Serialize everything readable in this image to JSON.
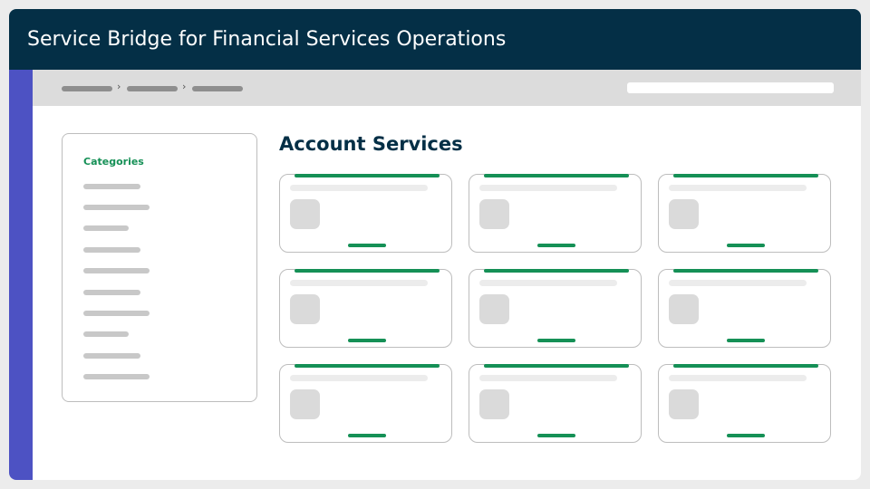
{
  "app": {
    "title": "Service Bridge for Financial Services Operations"
  },
  "sidebar": {
    "heading": "Categories",
    "item_count": 10
  },
  "main": {
    "section_title": "Account Services",
    "card_count": 9
  },
  "colors": {
    "titlebar": "#042f46",
    "rail": "#4d52c3",
    "accent_green": "#159056",
    "toolbar": "#dcdcdc"
  },
  "icons": {
    "breadcrumb_separator": "chevron-right-icon"
  }
}
